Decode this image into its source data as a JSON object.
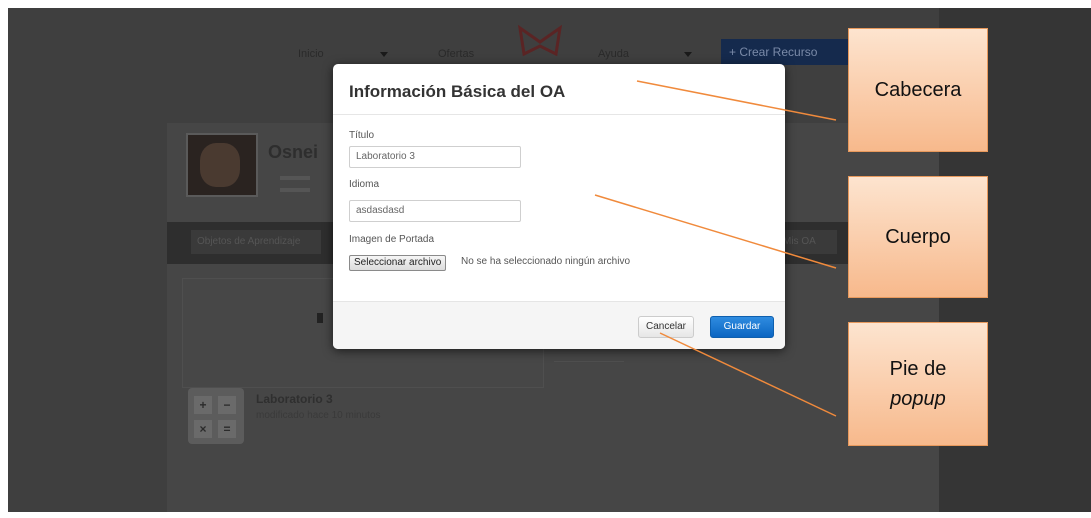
{
  "background_app": {
    "nav_items": [
      "Inicio",
      "Ofertas",
      "Ayuda"
    ],
    "create_button": "+ Crear Recurso",
    "profile_name": "Osnei",
    "tabs": [
      "Objetos de Aprendizaje",
      "Mis OA"
    ],
    "item": {
      "title": "Laboratorio 3",
      "subtitle": "modificado hace 10 minutos"
    }
  },
  "modal": {
    "title": "Información Básica del OA",
    "fields": {
      "title_label": "Título",
      "title_value": "Laboratorio 3",
      "language_label": "Idioma",
      "language_value": "asdasdasd",
      "cover_label": "Imagen de Portada"
    },
    "file_button": "Seleccionar archivo",
    "file_status": "No se ha seleccionado ningún archivo",
    "cancel_button": "Cancelar",
    "save_button": "Guardar"
  },
  "annotations": {
    "header": "Cabecera",
    "body": "Cuerpo",
    "footer_line1": "Pie de",
    "footer_line2": "popup"
  },
  "colors": {
    "overlay": "#3f3f3f",
    "primary": "#0b65c2",
    "callout_fill": "#f7b98c",
    "leader_line": "#f08a3c"
  }
}
